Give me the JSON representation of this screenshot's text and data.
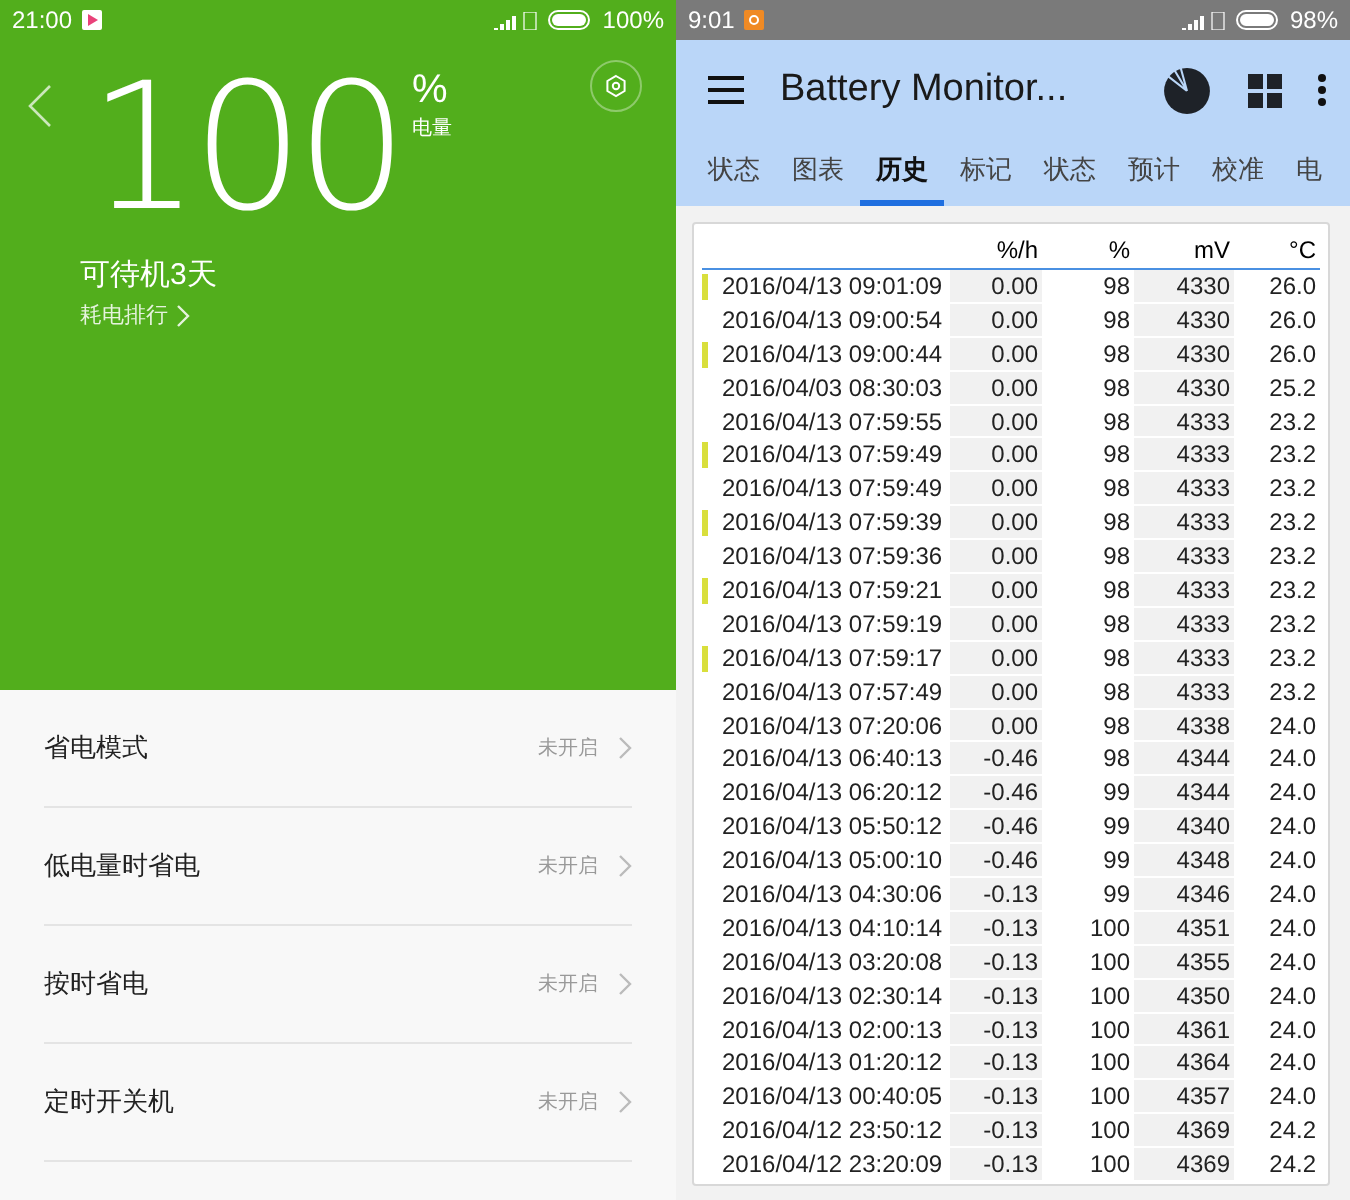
{
  "left_phone": {
    "status_bar": {
      "time": "21:00",
      "battery": "100%"
    },
    "header": {
      "level_value": "100",
      "percent_sign": "%",
      "level_label": "电量",
      "standby": "可待机3天",
      "ranking_link": "耗电排行"
    },
    "settings": [
      {
        "label": "省电模式",
        "status": "未开启"
      },
      {
        "label": "低电量时省电",
        "status": "未开启"
      },
      {
        "label": "按时省电",
        "status": "未开启"
      },
      {
        "label": "定时开关机",
        "status": "未开启"
      }
    ]
  },
  "right_phone": {
    "status_bar": {
      "time": "9:01",
      "battery": "98%"
    },
    "app_bar": {
      "title": "Battery Monitor..."
    },
    "tabs": [
      {
        "label": "状态",
        "selected": false
      },
      {
        "label": "图表",
        "selected": false
      },
      {
        "label": "历史",
        "selected": true
      },
      {
        "label": "标记",
        "selected": false
      },
      {
        "label": "状态",
        "selected": false
      },
      {
        "label": "预计",
        "selected": false
      },
      {
        "label": "校准",
        "selected": false
      },
      {
        "label": "电",
        "selected": false
      }
    ],
    "table": {
      "columns": [
        "%/h",
        "%",
        "mV",
        "°C"
      ],
      "rows": [
        {
          "marked": true,
          "time": "2016/04/13 09:01:09",
          "rate": "0.00",
          "percent": "98",
          "mv": "4330",
          "temp": "26.0"
        },
        {
          "marked": false,
          "time": "2016/04/13 09:00:54",
          "rate": "0.00",
          "percent": "98",
          "mv": "4330",
          "temp": "26.0"
        },
        {
          "marked": true,
          "time": "2016/04/13 09:00:44",
          "rate": "0.00",
          "percent": "98",
          "mv": "4330",
          "temp": "26.0"
        },
        {
          "marked": false,
          "time": "2016/04/03 08:30:03",
          "rate": "0.00",
          "percent": "98",
          "mv": "4330",
          "temp": "25.2"
        },
        {
          "marked": false,
          "time": "2016/04/13 07:59:55",
          "rate": "0.00",
          "percent": "98",
          "mv": "4333",
          "temp": "23.2"
        },
        {
          "marked": true,
          "time": "2016/04/13 07:59:49",
          "rate": "0.00",
          "percent": "98",
          "mv": "4333",
          "temp": "23.2"
        },
        {
          "marked": false,
          "time": "2016/04/13 07:59:49",
          "rate": "0.00",
          "percent": "98",
          "mv": "4333",
          "temp": "23.2"
        },
        {
          "marked": true,
          "time": "2016/04/13 07:59:39",
          "rate": "0.00",
          "percent": "98",
          "mv": "4333",
          "temp": "23.2"
        },
        {
          "marked": false,
          "time": "2016/04/13 07:59:36",
          "rate": "0.00",
          "percent": "98",
          "mv": "4333",
          "temp": "23.2"
        },
        {
          "marked": true,
          "time": "2016/04/13 07:59:21",
          "rate": "0.00",
          "percent": "98",
          "mv": "4333",
          "temp": "23.2"
        },
        {
          "marked": false,
          "time": "2016/04/13 07:59:19",
          "rate": "0.00",
          "percent": "98",
          "mv": "4333",
          "temp": "23.2"
        },
        {
          "marked": true,
          "time": "2016/04/13 07:59:17",
          "rate": "0.00",
          "percent": "98",
          "mv": "4333",
          "temp": "23.2"
        },
        {
          "marked": false,
          "time": "2016/04/13 07:57:49",
          "rate": "0.00",
          "percent": "98",
          "mv": "4333",
          "temp": "23.2"
        },
        {
          "marked": false,
          "time": "2016/04/13 07:20:06",
          "rate": "0.00",
          "percent": "98",
          "mv": "4338",
          "temp": "24.0"
        },
        {
          "marked": false,
          "time": "2016/04/13 06:40:13",
          "rate": "-0.46",
          "percent": "98",
          "mv": "4344",
          "temp": "24.0"
        },
        {
          "marked": false,
          "time": "2016/04/13 06:20:12",
          "rate": "-0.46",
          "percent": "99",
          "mv": "4344",
          "temp": "24.0"
        },
        {
          "marked": false,
          "time": "2016/04/13 05:50:12",
          "rate": "-0.46",
          "percent": "99",
          "mv": "4340",
          "temp": "24.0"
        },
        {
          "marked": false,
          "time": "2016/04/13 05:00:10",
          "rate": "-0.46",
          "percent": "99",
          "mv": "4348",
          "temp": "24.0"
        },
        {
          "marked": false,
          "time": "2016/04/13 04:30:06",
          "rate": "-0.13",
          "percent": "99",
          "mv": "4346",
          "temp": "24.0"
        },
        {
          "marked": false,
          "time": "2016/04/13 04:10:14",
          "rate": "-0.13",
          "percent": "100",
          "mv": "4351",
          "temp": "24.0"
        },
        {
          "marked": false,
          "time": "2016/04/13 03:20:08",
          "rate": "-0.13",
          "percent": "100",
          "mv": "4355",
          "temp": "24.0"
        },
        {
          "marked": false,
          "time": "2016/04/13 02:30:14",
          "rate": "-0.13",
          "percent": "100",
          "mv": "4350",
          "temp": "24.0"
        },
        {
          "marked": false,
          "time": "2016/04/13 02:00:13",
          "rate": "-0.13",
          "percent": "100",
          "mv": "4361",
          "temp": "24.0"
        },
        {
          "marked": false,
          "time": "2016/04/13 01:20:12",
          "rate": "-0.13",
          "percent": "100",
          "mv": "4364",
          "temp": "24.0"
        },
        {
          "marked": false,
          "time": "2016/04/13 00:40:05",
          "rate": "-0.13",
          "percent": "100",
          "mv": "4357",
          "temp": "24.0"
        },
        {
          "marked": false,
          "time": "2016/04/12 23:50:12",
          "rate": "-0.13",
          "percent": "100",
          "mv": "4369",
          "temp": "24.2"
        },
        {
          "marked": false,
          "time": "2016/04/12 23:20:09",
          "rate": "-0.13",
          "percent": "100",
          "mv": "4369",
          "temp": "24.2"
        }
      ]
    }
  }
}
